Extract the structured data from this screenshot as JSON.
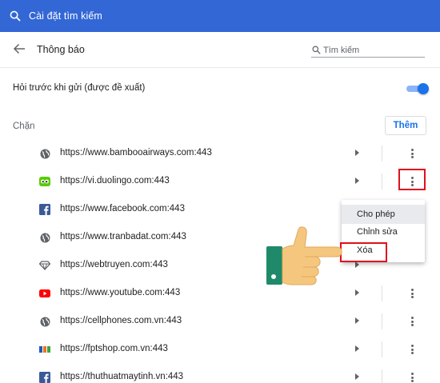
{
  "topbar": {
    "title": "Cài đặt tìm kiếm"
  },
  "header": {
    "title": "Thông báo",
    "search_placeholder": "Tìm kiếm"
  },
  "ask_setting": {
    "label": "Hỏi trước khi gửi (được đề xuất)",
    "enabled": true
  },
  "block_section": {
    "label": "Chặn",
    "add_button": "Thêm"
  },
  "sites": [
    {
      "icon": "globe-icon",
      "url": "https://www.bambooairways.com:443"
    },
    {
      "icon": "duolingo-icon",
      "url": "https://vi.duolingo.com:443"
    },
    {
      "icon": "facebook-icon",
      "url": "https://www.facebook.com:443"
    },
    {
      "icon": "globe-icon",
      "url": "https://www.tranbadat.com:443"
    },
    {
      "icon": "diamond-icon",
      "url": "https://webtruyen.com:443"
    },
    {
      "icon": "youtube-icon",
      "url": "https://www.youtube.com:443"
    },
    {
      "icon": "globe-icon",
      "url": "https://cellphones.com.vn:443"
    },
    {
      "icon": "fptshop-icon",
      "url": "https://fptshop.com.vn:443"
    },
    {
      "icon": "facebook-icon",
      "url": "https://thuthuatmaytinh.vn:443"
    }
  ],
  "context_menu": {
    "items": [
      {
        "label": "Cho phép",
        "highlighted": true
      },
      {
        "label": "Chỉnh sửa",
        "highlighted": false
      },
      {
        "label": "Xóa",
        "highlighted": false
      }
    ]
  },
  "colors": {
    "topbar": "#3367d6",
    "accent": "#1a73e8",
    "annotation_red": "#e0101d",
    "hand_skin": "#f5c77e",
    "hand_cuff": "#1f8a6a"
  }
}
